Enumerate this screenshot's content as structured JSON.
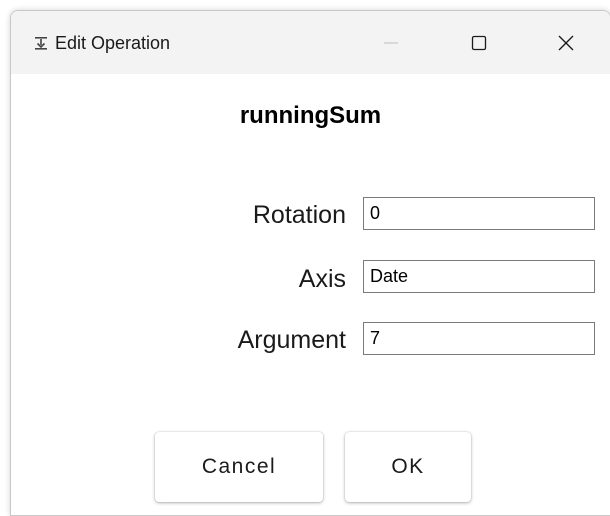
{
  "window": {
    "title": "Edit Operation",
    "app_icon": "arrow-down-bar-icon",
    "controls": {
      "minimize_icon": "minimize-icon",
      "maximize_icon": "maximize-icon",
      "close_icon": "close-icon"
    }
  },
  "dialog": {
    "operation_name": "runningSum",
    "fields": [
      {
        "label": "Rotation",
        "value": "0"
      },
      {
        "label": "Axis",
        "value": "Date"
      },
      {
        "label": "Argument",
        "value": "7"
      }
    ],
    "buttons": {
      "cancel_label": "Cancel",
      "ok_label": "OK"
    }
  },
  "colors": {
    "titlebar_bg": "#f3f3f3",
    "window_bg": "#ffffff",
    "input_border": "#7a7a7a"
  }
}
